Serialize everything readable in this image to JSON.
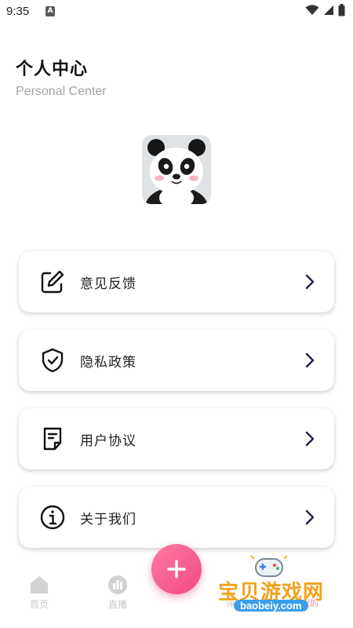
{
  "status_bar": {
    "time": "9:35",
    "notification_badge": "A"
  },
  "header": {
    "title": "个人中心",
    "subtitle": "Personal Center"
  },
  "avatar": {
    "icon": "panda-avatar"
  },
  "menu": {
    "items": [
      {
        "label": "意见反馈",
        "icon": "edit-icon"
      },
      {
        "label": "隐私政策",
        "icon": "shield-check-icon"
      },
      {
        "label": "用户协议",
        "icon": "document-icon"
      },
      {
        "label": "关于我们",
        "icon": "info-icon"
      }
    ]
  },
  "tabbar": {
    "tabs": [
      {
        "label": "首页",
        "icon": "home-icon"
      },
      {
        "label": "直播",
        "icon": "live-icon"
      }
    ],
    "fab_icon": "plus-icon"
  },
  "colors": {
    "accent": "#f04a84",
    "inactive": "#c9c9c9",
    "chevron": "#1e2150"
  },
  "watermark": {
    "brand": "宝贝游戏网",
    "url": "baobeiy.com",
    "under_text_1": "弹",
    "under_text_2": "我的"
  }
}
